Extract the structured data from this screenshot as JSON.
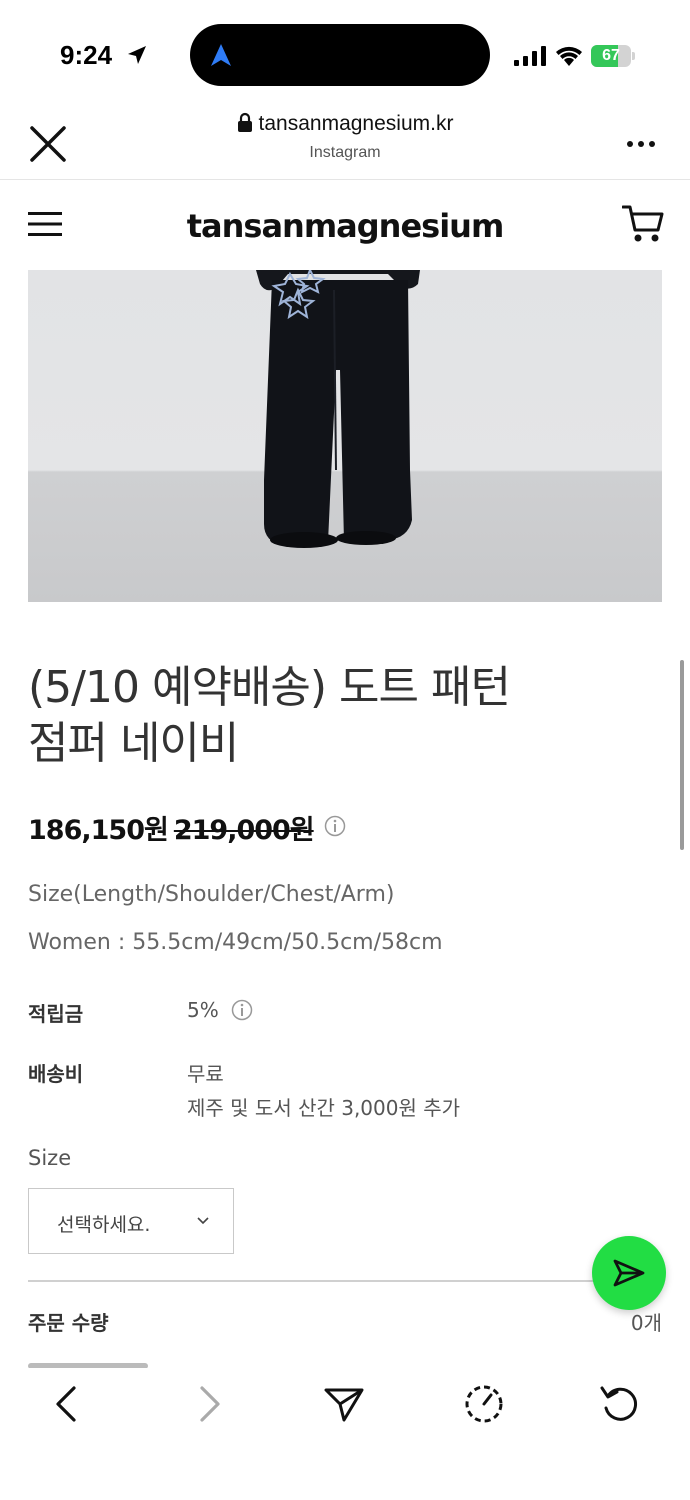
{
  "status_bar": {
    "time": "9:24",
    "battery_text": "67",
    "battery_level": 0.67,
    "colors": {
      "battery_fill": "#34c759",
      "island_icon": "#2f7cf6"
    }
  },
  "browser": {
    "url": "tansanmagnesium.kr",
    "source": "Instagram",
    "icons": [
      "close-icon",
      "lock-icon",
      "more-icon"
    ]
  },
  "site": {
    "brand": "tansanmagnesium",
    "icons": [
      "menu-icon",
      "cart-icon"
    ]
  },
  "product": {
    "title_line1": "(5/10 예약배송) 도트 패턴",
    "title_line2": "점퍼 네이비",
    "price": "186,150원",
    "original_price": "219,000원",
    "size_info": "Size(Length/Shoulder/Chest/Arm)",
    "size_women": "Women : 55.5cm/49cm/50.5cm/58cm",
    "points_label": "적립금",
    "points_value": "5%",
    "shipping_label": "배송비",
    "shipping_value": "무료",
    "shipping_note": "제주 및 도서 산간 3,000원 추가",
    "size_label": "Size",
    "size_select_placeholder": "선택하세요.",
    "qty_label": "주문 수량",
    "qty_value": "0개"
  },
  "toolbar": {
    "icons": [
      "back-icon",
      "forward-icon",
      "send-icon",
      "timer-icon",
      "refresh-icon"
    ]
  },
  "fab": {
    "icon": "send-icon",
    "color": "#22dd44"
  }
}
